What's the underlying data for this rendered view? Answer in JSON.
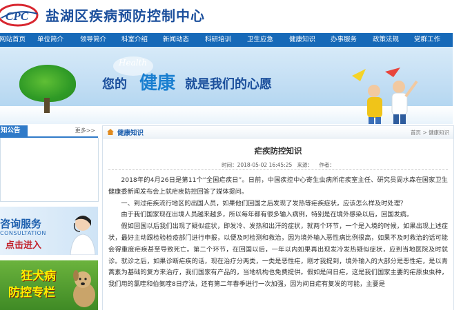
{
  "header": {
    "logo_text": "CPC",
    "site_title": "盐湖区疾病预防控制中心"
  },
  "nav": {
    "items": [
      "网站首页",
      "单位简介",
      "领导简介",
      "科室介绍",
      "新闻动态",
      "科研培训",
      "卫生应急",
      "健康知识",
      "办事服务",
      "政策法规",
      "党群工作"
    ]
  },
  "banner": {
    "health_word": "Health",
    "slogan_prefix": "您的",
    "slogan_emphasis": "健康",
    "slogan_suffix": "就是我们的心愿"
  },
  "sidebar": {
    "notice_title": "知公告",
    "notice_more": "更多>>",
    "consult_line1": "咨询服务",
    "consult_line2": "CONSULTATION",
    "consult_line3": "点击进入",
    "rabies_line1": "狂犬病",
    "rabies_line2": "防控专栏"
  },
  "main": {
    "section_title": "健康知识",
    "breadcrumb": "首页 > 健康知识",
    "article_title": "疟疾防控知识",
    "article_meta": "时间：2018-05-02 16:45:25   来源：    作者：",
    "paragraphs": [
      "2018年的4月26日是第11个“全国疟疾日”。日前，中国疾控中心寄生虫病所疟疾室主任、研究员周水森在国家卫生健康委新闻发布会上就疟疾防控回答了媒体提问。",
      "一、到过疟疾流行地区的出国人员，如果他们回国之后发现了发热等疟疾症状，应该怎么样及时处理？",
      "由于我们国家现在出境人员越来越多，所以每年都有很多输入病例，特别是在境外感染以后，回国发病。",
      "假如回国以后我们出现了疑似症状，即发冷、发热和出汗的症状，就两个环节，一个是入境的时候，如果出现上述症状，最好主动跟检验检疫部门进行申报，以便及时检测和救治，因为境外输入恶性病比例很高，如果不及时救治的话可能会得重度疟疾甚至导致死亡。第二个环节，在回国以后，一年以内如果再出现发冷发热疑似症状，应到当地医院及时就诊。就诊之后，如果诊断疟疾的话，现在治疗分两类，一类是恶性疟，刚才我提到，境外输入的大部分是恶性疟，是以青蒿素为基础的复方来治疗，我们国家有产品的，当地机构也免费提供。假如是间日疟，这是我们国家主要的疟原虫虫种，我们用的氯喹和伯氨喹8日疗法，还有第二年春季进行一次加强，因为间日疟有复发的可能，主要是"
    ]
  },
  "colors": {
    "nav_bg": "#1669b8",
    "title_blue": "#1b4f9c",
    "accent_red": "#c2202a"
  }
}
